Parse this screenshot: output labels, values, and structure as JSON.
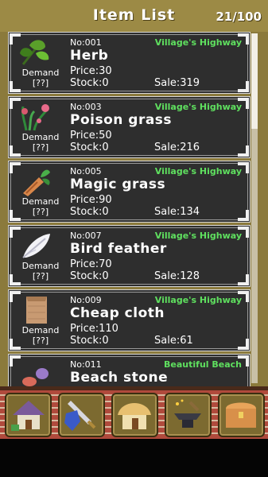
{
  "header": {
    "title": "Item List",
    "count": "21/100"
  },
  "items": [
    {
      "no": "No:001",
      "location": "Village's Highway",
      "name": "Herb",
      "price": "Price:30",
      "stock": "Stock:0",
      "sale": "Sale:319",
      "demand": "Demand",
      "demand_value": "[??]",
      "icon": "herb-icon"
    },
    {
      "no": "No:003",
      "location": "Village's Highway",
      "name": "Poison grass",
      "price": "Price:50",
      "stock": "Stock:0",
      "sale": "Sale:216",
      "demand": "Demand",
      "demand_value": "[??]",
      "icon": "poison-grass-icon"
    },
    {
      "no": "No:005",
      "location": "Village's Highway",
      "name": "Magic grass",
      "price": "Price:90",
      "stock": "Stock:0",
      "sale": "Sale:134",
      "demand": "Demand",
      "demand_value": "[??]",
      "icon": "magic-grass-icon"
    },
    {
      "no": "No:007",
      "location": "Village's Highway",
      "name": "Bird feather",
      "price": "Price:70",
      "stock": "Stock:0",
      "sale": "Sale:128",
      "demand": "Demand",
      "demand_value": "[??]",
      "icon": "bird-feather-icon"
    },
    {
      "no": "No:009",
      "location": "Village's Highway",
      "name": "Cheap cloth",
      "price": "Price:110",
      "stock": "Stock:0",
      "sale": "Sale:61",
      "demand": "Demand",
      "demand_value": "[??]",
      "icon": "cheap-cloth-icon"
    },
    {
      "no": "No:011",
      "location": "Beautiful Beach",
      "name": "Beach stone",
      "icon": "beach-stone-icon"
    }
  ],
  "nav": [
    {
      "icon": "house-icon"
    },
    {
      "icon": "sword-shield-icon"
    },
    {
      "icon": "hut-icon"
    },
    {
      "icon": "anvil-icon"
    },
    {
      "icon": "treasure-chest-icon"
    }
  ],
  "colors": {
    "location": "#5fe05f",
    "card_bg": "#2e2e2e",
    "frame": "#9c8a45"
  }
}
